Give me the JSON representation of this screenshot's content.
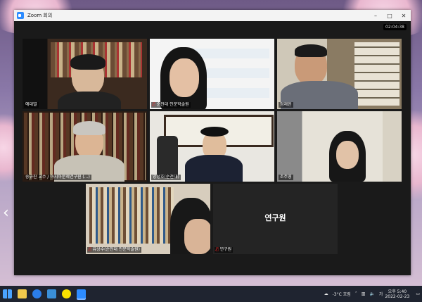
{
  "window": {
    "title": "Zoom 회의",
    "timer": "02:04:38",
    "controls": [
      "–",
      "□",
      "✕"
    ]
  },
  "participants": [
    {
      "name": "에대열",
      "muted": false
    },
    {
      "name": "순천대 인문학술원",
      "muted": true
    },
    {
      "name": "정재헌",
      "muted": false
    },
    {
      "name": "송규진 교수 / 아시아문제연구원 (...)",
      "muted": false,
      "active": true
    },
    {
      "name": "양성호(순천대)",
      "muted": false
    },
    {
      "name": "조주영",
      "muted": false
    },
    {
      "name": "유상수(순천대 인문학술원)",
      "muted": true
    },
    {
      "name": "연구원",
      "muted": true,
      "video_off": true
    }
  ],
  "taskbar": {
    "apps": [
      "windows-logo",
      "file-explorer",
      "edge",
      "store",
      "kakaotalk",
      "zoom"
    ],
    "weather": "-3°C 흐림",
    "ime": "가",
    "time": "오후 5:40",
    "date": "2022-02-23"
  },
  "colors": {
    "accent": "#2d8cff",
    "active_border": "#b9e06a",
    "mic_off": "#e02828"
  }
}
